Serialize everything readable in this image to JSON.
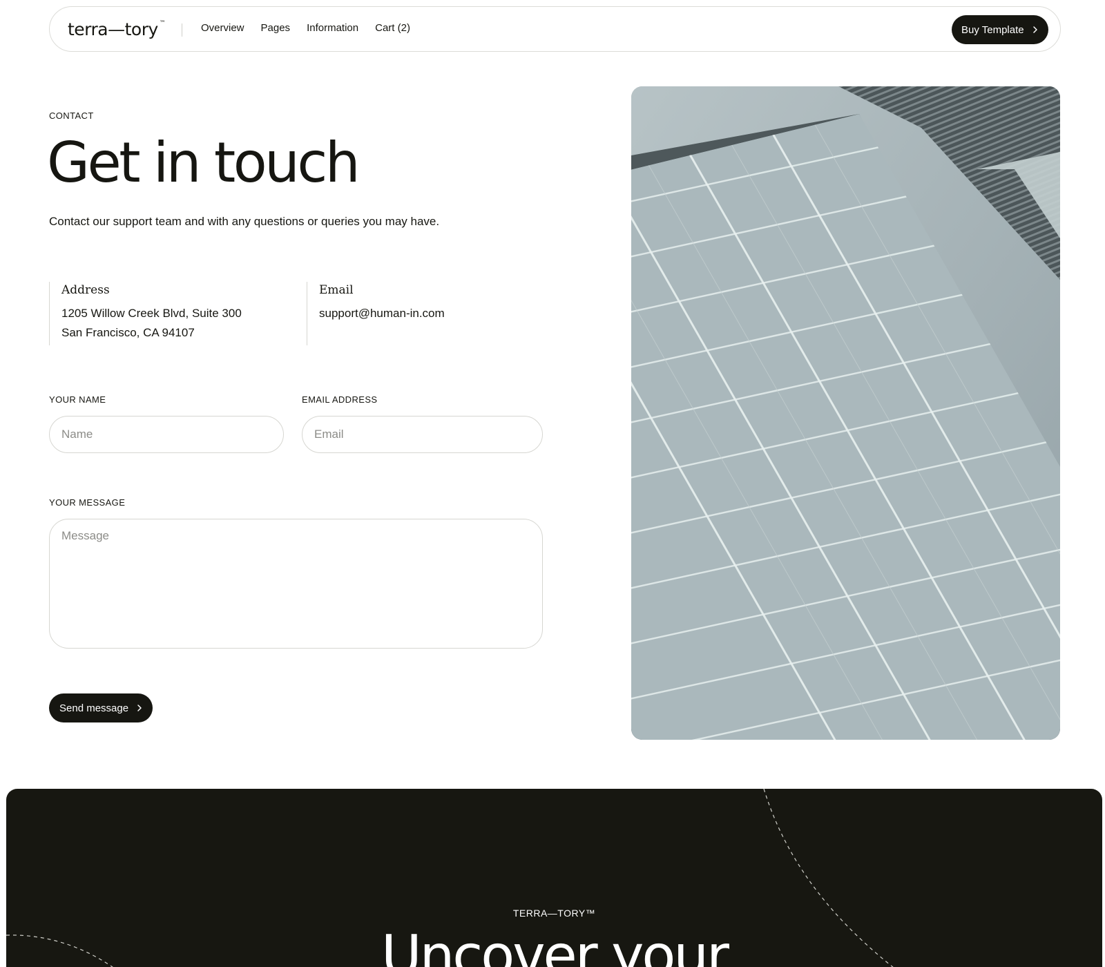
{
  "nav": {
    "logo": "terra—tory",
    "logo_mark": "™",
    "links": [
      "Overview",
      "Pages",
      "Information",
      "Cart (2)"
    ],
    "cta": "Buy Template"
  },
  "contact": {
    "eyebrow": "CONTACT",
    "title": "Get in touch",
    "lead": "Contact our support team and with any questions or queries you may have.",
    "address": {
      "label": "Address",
      "line1": "1205 Willow Creek Blvd, Suite 300",
      "line2": "San Francisco, CA 94107"
    },
    "email": {
      "label": "Email",
      "value": "support@human-in.com"
    }
  },
  "form": {
    "name_label": "YOUR NAME",
    "name_placeholder": "Name",
    "email_label": "EMAIL ADDRESS",
    "email_placeholder": "Email",
    "message_label": "YOUR MESSAGE",
    "message_placeholder": "Message",
    "submit": "Send message"
  },
  "footer": {
    "brand": "TERRA—TORY™",
    "heading": "Uncover your"
  },
  "colors": {
    "ink": "#161611",
    "footer_bg": "#171711",
    "border": "#d6d6d1"
  }
}
